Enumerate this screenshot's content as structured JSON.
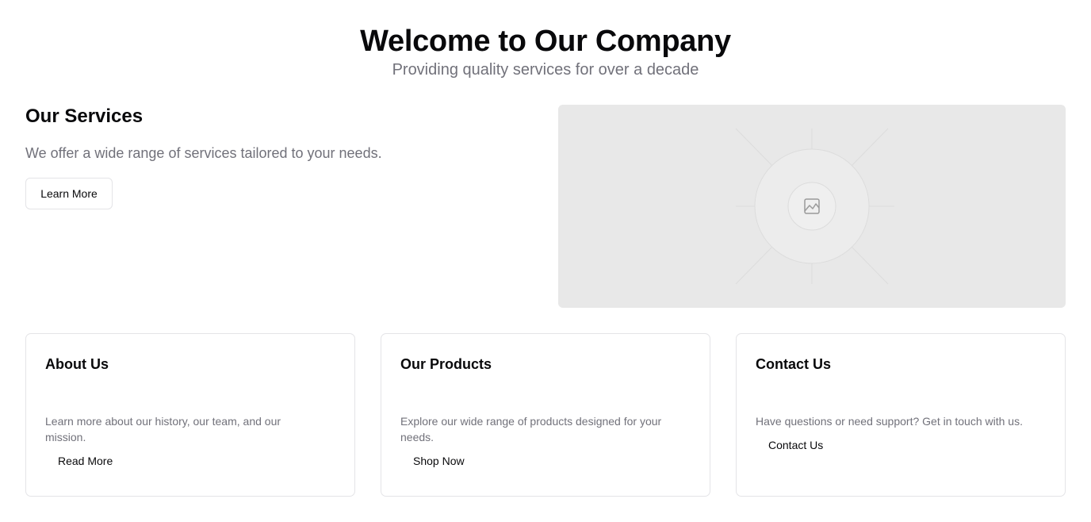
{
  "hero": {
    "title": "Welcome to Our Company",
    "subtitle": "Providing quality services for over a decade"
  },
  "services": {
    "heading": "Our Services",
    "description": "We offer a wide range of services tailored to your needs.",
    "button_label": "Learn More"
  },
  "image_placeholder": {
    "icon": "image-icon",
    "background": "#e8e8e8"
  },
  "cards": [
    {
      "title": "About Us",
      "text": "Learn more about our history, our team, and our mission.",
      "button_label": "Read More"
    },
    {
      "title": "Our Products",
      "text": "Explore our wide range of products designed for your needs.",
      "button_label": "Shop Now"
    },
    {
      "title": "Contact Us",
      "text": "Have questions or need support? Get in touch with us.",
      "button_label": "Contact Us"
    }
  ],
  "colors": {
    "text": "#09090b",
    "muted": "#71717a",
    "border": "#e4e4e7"
  }
}
